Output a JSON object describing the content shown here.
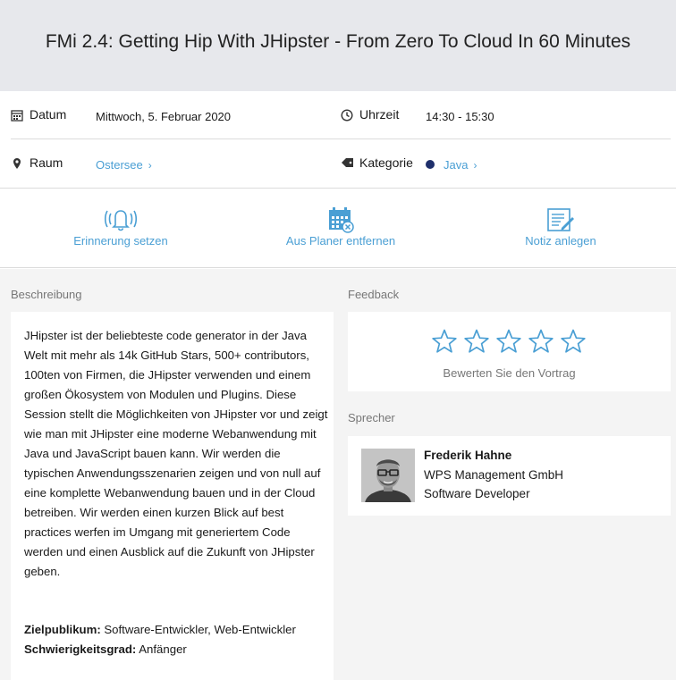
{
  "header": {
    "title": "FMi 2.4: Getting Hip With JHipster - From Zero To Cloud In 60 Minutes"
  },
  "info": {
    "date_label": "Datum",
    "date_value": "Mittwoch, 5. Februar 2020",
    "time_label": "Uhrzeit",
    "time_value": "14:30 - 15:30",
    "room_label": "Raum",
    "room_value": "Ostersee",
    "category_label": "Kategorie",
    "category_value": "Java",
    "category_color": "#1f2f6b"
  },
  "actions": {
    "reminder": "Erinnerung setzen",
    "remove_planner": "Aus Planer entfernen",
    "note": "Notiz anlegen"
  },
  "description": {
    "title": "Beschreibung",
    "body": "JHipster ist der beliebteste code generator in der Java Welt mit mehr als 14k GitHub Stars, 500+ contributors, 100ten von Firmen, die JHipster verwenden und einem großen Ökosystem von Modulen und Plugins.  Diese Session stellt die Möglichkeiten von JHipster vor und zeigt wie man mit JHipster eine moderne Webanwendung mit Java und JavaScript bauen kann. Wir werden die typischen Anwendungsszenarien zeigen und von null auf eine komplette Webanwendung bauen und in der Cloud betreiben. Wir werden einen kurzen Blick auf best practices werfen im Umgang mit generiertem Code werden und einen Ausblick auf die Zukunft von JHipster geben.",
    "audience_label": "Zielpublikum:",
    "audience_value": "Software-Entwickler, Web-Entwickler",
    "difficulty_label": "Schwierigkeitsgrad:",
    "difficulty_value": "Anfänger"
  },
  "feedback": {
    "title": "Feedback",
    "rate_label": "Bewerten Sie den Vortrag",
    "stars_total": 5,
    "stars_selected": 0
  },
  "speakers": {
    "title": "Sprecher",
    "items": [
      {
        "name": "Frederik Hahne",
        "company": "WPS Management GmbH",
        "role": "Software Developer"
      }
    ]
  },
  "colors": {
    "accent": "#4a9fd4",
    "header_bg": "#e7e8ec",
    "section_bg": "#f4f4f4"
  }
}
